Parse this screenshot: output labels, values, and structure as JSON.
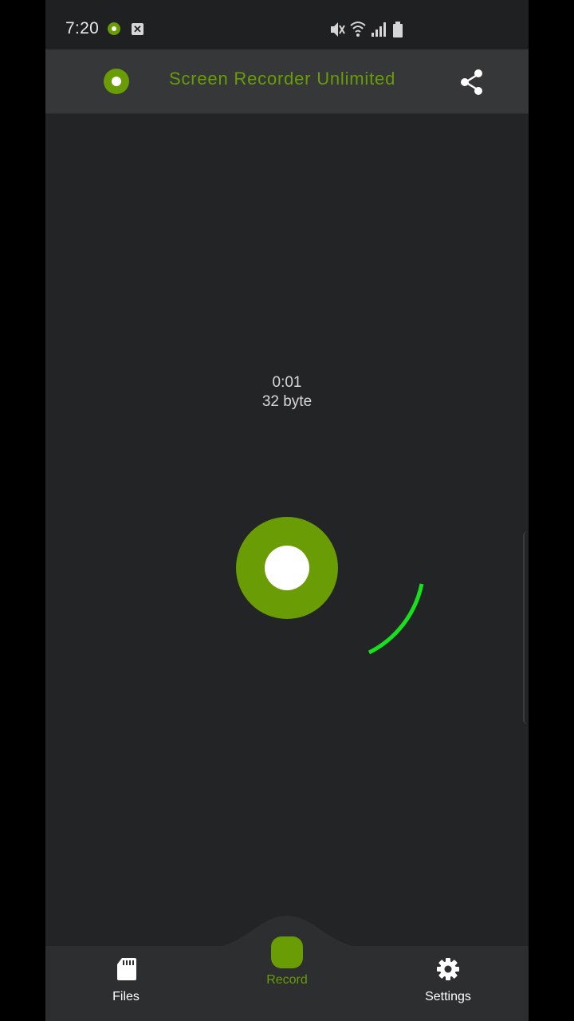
{
  "status_bar": {
    "time": "7:20",
    "icons": [
      "record-notification-icon",
      "close-notification-icon",
      "mute-icon",
      "wifi-icon",
      "signal-icon",
      "battery-icon"
    ]
  },
  "app_bar": {
    "title": "Screen Recorder Unlimited",
    "logo_icon": "record-logo-icon",
    "share_icon": "share-icon"
  },
  "recording": {
    "elapsed": "0:01",
    "size": "32 byte",
    "accent_color": "#6a9c05",
    "arc_color": "#19e01e"
  },
  "bottom_nav": {
    "files_label": "Files",
    "record_label": "Record",
    "settings_label": "Settings",
    "active_tab": "Record"
  }
}
